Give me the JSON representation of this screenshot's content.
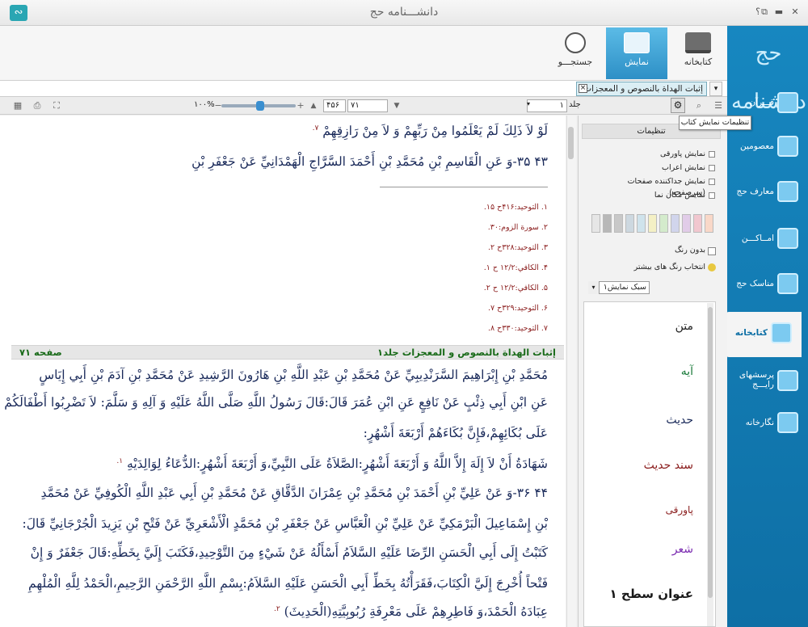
{
  "window": {
    "title": "دانشـــنامه حج",
    "help": "؟",
    "restore": "⧉",
    "minimize": "▬",
    "maximize": "□",
    "close": "✕",
    "app_icon": "app-logo-icon"
  },
  "ribbon": {
    "tabs": [
      {
        "label": "کتابخانه",
        "icon": "books-icon"
      },
      {
        "label": "نمایش",
        "icon": "display-icon",
        "active": true
      },
      {
        "label": "جستجـــو",
        "icon": "search-magnifier-icon"
      }
    ]
  },
  "sidebar": {
    "logo": "حج دانشنامه",
    "items": [
      {
        "label": "قـــرآن",
        "icon": "quran-icon"
      },
      {
        "label": "معصومین",
        "icon": "masumin-icon"
      },
      {
        "label": "معارف حج",
        "icon": "hajj-knowledge-icon"
      },
      {
        "label": "امــاکـــن",
        "icon": "places-icon"
      },
      {
        "label": "مناسک حج",
        "icon": "rites-icon"
      },
      {
        "label": "کتابخانه",
        "icon": "library-icon",
        "active": true
      },
      {
        "label": "پرسشهای رایـــج",
        "icon": "faq-icon"
      },
      {
        "label": "نگارخانه",
        "icon": "gallery-icon"
      }
    ]
  },
  "doc_tab": {
    "label": "إثبات الهداة بالنصوص و المعجزات",
    "close": "×",
    "dropdown": "▾"
  },
  "toolbar": {
    "zoom": "۱۰۰%",
    "zoom_minus": "−",
    "zoom_plus": "+",
    "page_current": "۷۱",
    "page_total": "۴۵۶",
    "volume_label": "جلد",
    "volume_value": "۱",
    "up_arrow": "▲",
    "down_arrow": "▼"
  },
  "tooltip": "تنظیمات نمایش کتاب",
  "content": {
    "top_lines": [
      "لَوْ لاَ ذَلِكَ لَمْ يَعْلَمُوا مِنْ رَبِّهِمْ وَ لاَ مِنْ رَازِقِهِمْ ^٧.",
      "۴۳ ۳۵-وَ عَنِ الْقَاسِمِ بْنِ مُحَمَّدِ بْنِ أَحْمَدَ السَّرَّاجِ الْهَمْدَانِيِّ عَنْ جَعْفَرِ بْنِ"
    ],
    "footnotes": [
      "۱. التوحيد:۴۱۶ح ۱۵.",
      "۲. سورة الزوم:۳۰.",
      "۳. التوحيد:۳۲۸ح ۲.",
      "۴. الكافي:۱۲/۲ ح ۱.",
      "۵. الكافي:۱۲/۲ ح ۲.",
      "۶. التوحيد:۳۲۹ح ۷.",
      "۷. التوحيد:۳۳۰ح ۸."
    ],
    "page_header_title": "إثبات الهداة بالنصوص و المعجزات جلد۱",
    "page_header_page": "صفحه ۷۱",
    "lines": [
      "مُحَمَّدِ بْنِ إِبْرَاهِيمَ السَّرَنْدِيبِيِّ عَنْ مُحَمَّدِ بْنِ عَبْدِ اللَّهِ بْنِ هَارُونَ الرَّشِيدِ عَنْ مُحَمَّدِ بْنِ آدَمَ بْنِ أَبِي إِيَاسٍ",
      "عَنِ ابْنِ أَبِي ذِئْبٍ عَنْ نَافِعٍ عَنِ ابْنِ عُمَرَ قَالَ:قَالَ رَسُولُ اللَّهِ صَلَّى اللَّهُ عَلَيْهِ وَ آلِهِ وَ سَلَّمَ: لاَ تَضْرِبُوا أَطْفَالَكُمْ",
      "عَلَى بُكَائِهِمْ،فَإِنَّ بُكَاءَهُمْ أَرْبَعَةَ أَشْهُرٍ:",
      "شَهَادَةُ أَنْ لاَ إِلَهَ إِلاَّ اللَّهُ وَ أَرْبَعَةَ أَشْهُرٍ:الصَّلاَةُ عَلَى النَّبِيِّ،وَ أَرْبَعَةَ أَشْهُرٍ:الدُّعَاءُ لِوَالِدَيْهِ ^١.",
      "۴۴ ۳۶-وَ عَنْ عَلِيِّ بْنِ أَحْمَدَ بْنِ مُحَمَّدِ بْنِ عِمْرَانَ الدَّقَّاقِ عَنْ مُحَمَّدِ بْنِ أَبِي عَبْدِ اللَّهِ الْكُوفِيِّ عَنْ مُحَمَّدِ",
      "بْنِ إِسْمَاعِيلَ الْبَرْمَكِيِّ عَنْ عَلِيِّ بْنِ الْعَبَّاسِ عَنْ جَعْفَرِ بْنِ مُحَمَّدٍ الْأَشْعَرِيِّ عَنْ فَتْحِ بْنِ يَزِيدَ الْجُرْجَانِيِّ قَالَ:",
      "كَتَبْتُ إِلَى أَبِي الْحَسَنِ الرِّضَا عَلَيْهِ السَّلاَمُ أَسْأَلُهُ عَنْ شَيْءٍ مِنَ التَّوْحِيدِ،فَكَتَبَ إِلَيَّ بِخَطِّهِ:قَالَ جَعْفَرٌ وَ إِنْ",
      "فَتْحاً أُخْرِجَ إِلَيَّ الْكِتَابَ،فَقَرَأْتُهُ بِخَطِّ أَبِي الْحَسَنِ عَلَيْهِ السَّلاَمُ:بِسْمِ اللَّهِ الرَّحْمَنِ الرَّحِيمِ،الْحَمْدُ لِلَّهِ الْمُلْهِمِ",
      "عِبَادَهُ الْحَمْدَ،وَ فَاطِرِهِمْ عَلَى مَعْرِفَةِ رُبُوبِيَّتِهِ(الْحَدِيثَ) ^٢."
    ]
  },
  "settings": {
    "title": "تنظیمات",
    "checks": [
      "نمایش پاورقی",
      "نمایش اعراب",
      "نمایش جداکننده صفحات (سرصفحه)",
      "نمایش مکان نما"
    ],
    "swatches": [
      "#f9d8c8",
      "#f1c7cf",
      "#e1cce8",
      "#d1d5ec",
      "#d4ebcc",
      "#f4f0c5",
      "#cfe3ec",
      "#cdd8e0",
      "#c8c8c8",
      "#b8b8b8",
      "#e6e6e6"
    ],
    "no_color": "بدون رنگ",
    "more_colors": "انتخاب رنگ های بیشتر",
    "style_select": "سبک نمایش۱",
    "styles": [
      {
        "label": "متن",
        "color": "#222222"
      },
      {
        "label": "آیه",
        "color": "#1a7a3a"
      },
      {
        "label": "حدیث",
        "color": "#1a2a5a"
      },
      {
        "label": "سند حدیث",
        "color": "#8a1c1c"
      },
      {
        "label": "پاورقی",
        "color": "#8a1c1c"
      },
      {
        "label": "شعر",
        "color": "#7a2ab0"
      },
      {
        "label": "عنوان سطح ۱",
        "color": "#1a1a1a"
      }
    ]
  }
}
